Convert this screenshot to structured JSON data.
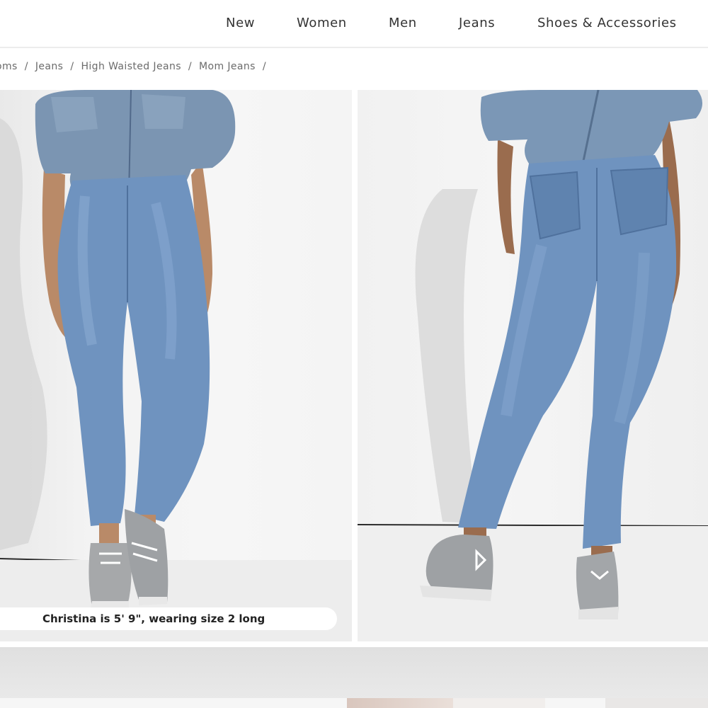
{
  "nav": {
    "items": [
      "New",
      "Women",
      "Men",
      "Jeans",
      "Shoes & Accessories"
    ]
  },
  "breadcrumb": {
    "items": [
      "oms",
      "Jeans",
      "High Waisted Jeans",
      "Mom Jeans"
    ],
    "separator": "/"
  },
  "gallery": {
    "caption": "Christina is 5' 9\", wearing size 2 long"
  },
  "colors": {
    "denim": "#6f93bf",
    "denim_dark": "#4f719d",
    "jacket": "#7a95b4",
    "background": "#f4f4f4"
  }
}
